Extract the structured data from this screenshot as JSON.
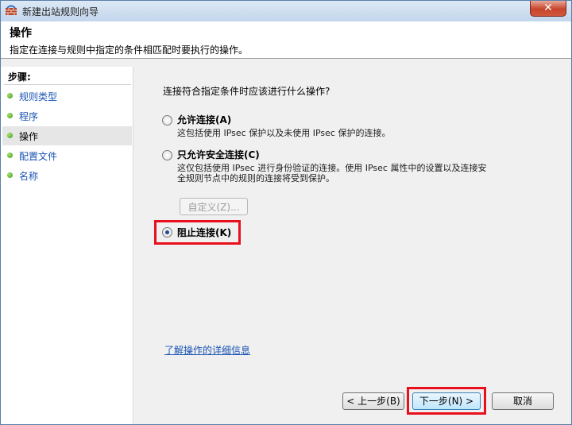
{
  "window": {
    "title": "新建出站规则向导",
    "close_glyph": "✕"
  },
  "header": {
    "title": "操作",
    "subtitle": "指定在连接与规则中指定的条件相匹配时要执行的操作。"
  },
  "nav": {
    "heading": "步骤:",
    "items": [
      {
        "label": "规则类型",
        "active": false
      },
      {
        "label": "程序",
        "active": false
      },
      {
        "label": "操作",
        "active": true
      },
      {
        "label": "配置文件",
        "active": false
      },
      {
        "label": "名称",
        "active": false
      }
    ]
  },
  "main": {
    "question": "连接符合指定条件时应该进行什么操作?",
    "options": [
      {
        "label": "允许连接(A)",
        "desc_lines": [
          "这包括使用 IPsec 保护以及未使用 IPsec 保护的连接。"
        ],
        "checked": false
      },
      {
        "label": "只允许安全连接(C)",
        "desc_lines": [
          "这仅包括使用 IPsec 进行身份验证的连接。使用 IPsec 属性中的设置以及连接安",
          "全规则节点中的规则的连接将受到保护。"
        ],
        "checked": false
      },
      {
        "label": "阻止连接(K)",
        "desc_lines": [],
        "checked": true
      }
    ],
    "customize_label": "自定义(Z)...",
    "learn_more_link": "了解操作的详细信息"
  },
  "buttons": {
    "back": "< 上一步(B)",
    "next": "下一步(N) >",
    "cancel": "取消"
  },
  "colors": {
    "highlight": "#e8101d",
    "link": "#1a53b4"
  }
}
